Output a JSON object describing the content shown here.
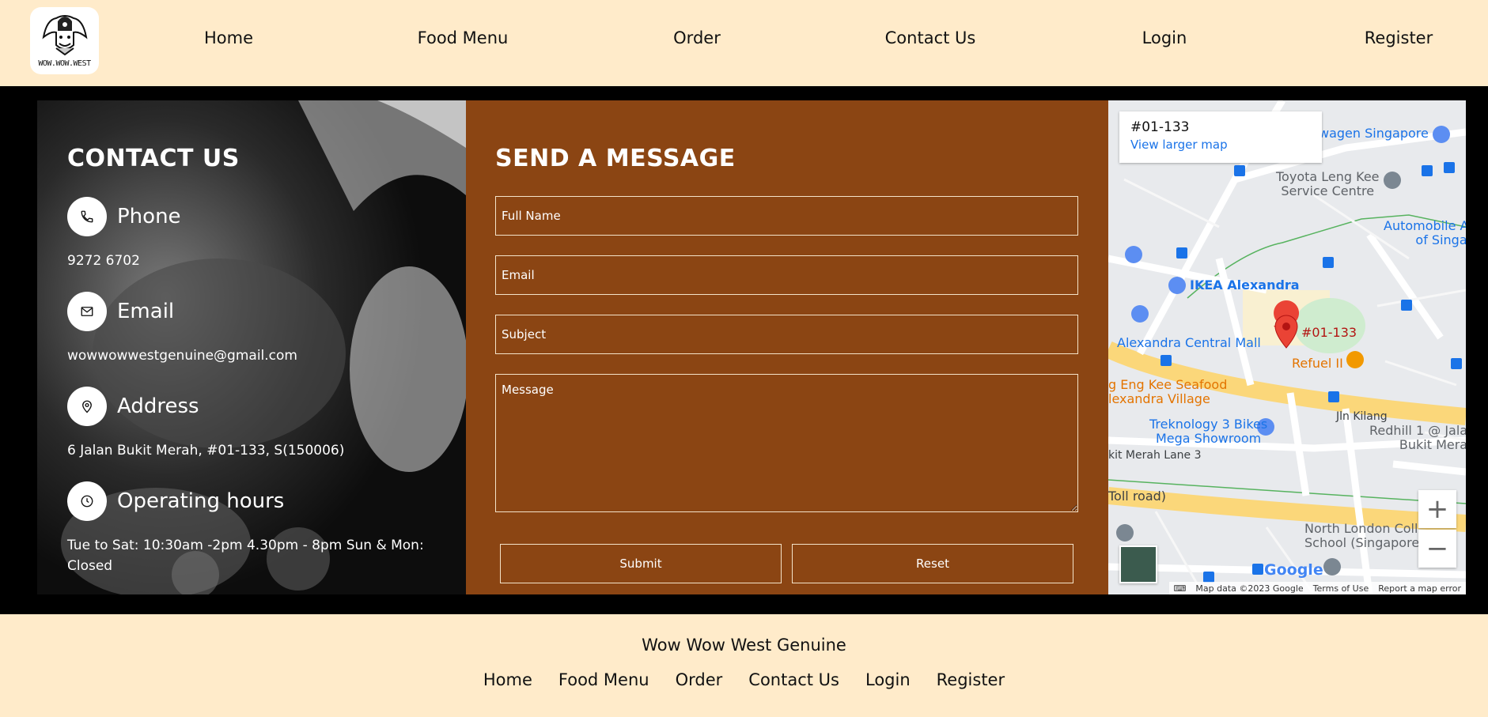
{
  "header": {
    "logo_text": "WOW.WOW.WEST",
    "nav": [
      "Home",
      "Food Menu",
      "Order",
      "Contact Us",
      "Login",
      "Register"
    ]
  },
  "contact": {
    "title": "CONTACT US",
    "phone_label": "Phone",
    "phone_value": "9272 6702",
    "email_label": "Email",
    "email_value": "wowwowwestgenuine@gmail.com",
    "address_label": "Address",
    "address_value": "6 Jalan Bukit Merah, #01-133, S(150006)",
    "hours_label": "Operating hours",
    "hours_value": "Tue to Sat: 10:30am -2pm 4.30pm - 8pm Sun & Mon: Closed"
  },
  "message": {
    "title": "SEND A MESSAGE",
    "full_name_placeholder": "Full Name",
    "email_placeholder": "Email",
    "subject_placeholder": "Subject",
    "message_placeholder": "Message",
    "submit_label": "Submit",
    "reset_label": "Reset"
  },
  "map": {
    "place": "#01-133",
    "view_larger": "View larger map",
    "labels": {
      "volkswagen": "wagen Singapore",
      "toyota": "Toyota Leng Kee\nService Centre",
      "automobile": "Automobile As\nof Singap",
      "ikea": "IKEA Alexandra",
      "alexandra_mall": "Alexandra Central Mall",
      "pin": "#01-133",
      "refuel": "Refuel II",
      "seafood": "g Eng Kee Seafood\nlexandra Village",
      "jln_kilang": "Jln Kilang",
      "treknology": "Treknology 3 Bikes\nMega Showroom",
      "redhill": "Redhill 1 @ Jala\nBukit Mera",
      "merah_lane": "kit Merah Lane 3",
      "toll": "Toll road)",
      "north_london": "North London Coll\nSchool (Singapore",
      "google": "Google"
    },
    "footer": [
      "Map data ©2023 Google",
      "Terms of Use",
      "Report a map error"
    ]
  },
  "footer": {
    "brand": "Wow Wow West Genuine",
    "nav": [
      "Home",
      "Food Menu",
      "Order",
      "Contact Us",
      "Login",
      "Register"
    ]
  },
  "colors": {
    "cream": "#ffebca",
    "brown": "#8b4513",
    "black": "#000000"
  }
}
